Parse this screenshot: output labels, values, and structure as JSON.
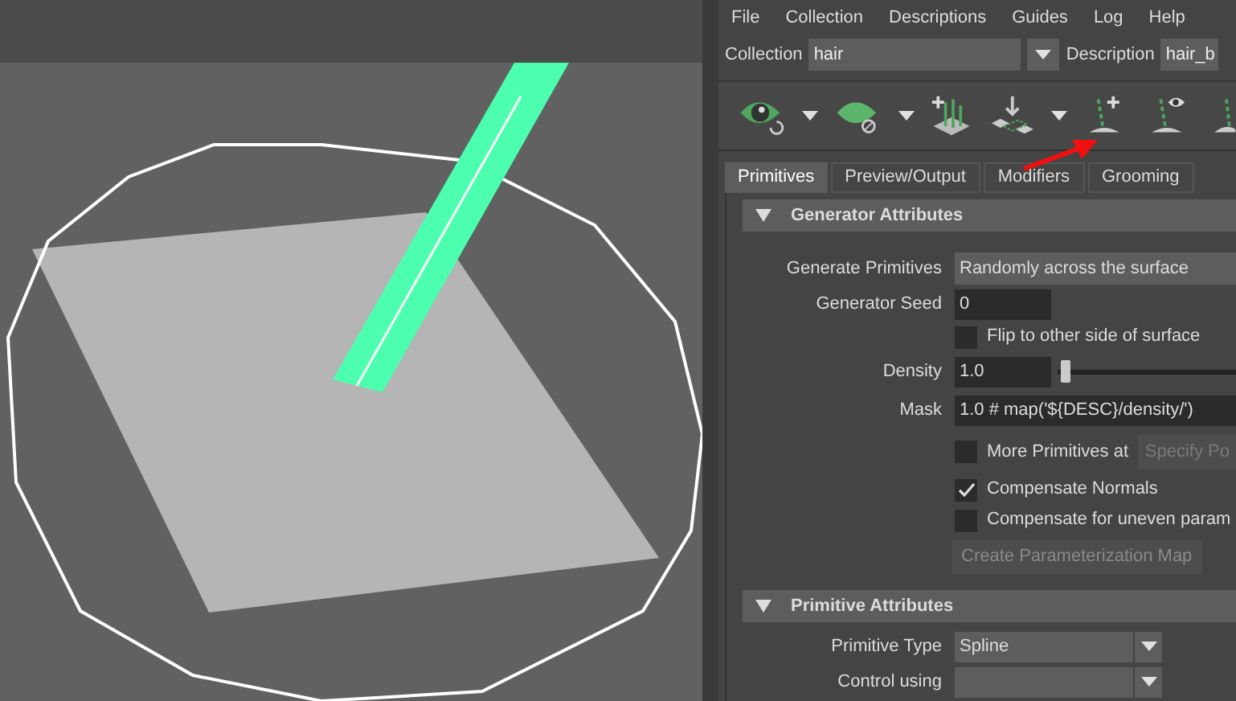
{
  "menu": [
    "File",
    "Collection",
    "Descriptions",
    "Guides",
    "Log",
    "Help"
  ],
  "selectors": [
    {
      "label": "Collection",
      "value": "hair",
      "dropdown": true
    },
    {
      "label": "Description",
      "value": "hair_b",
      "dropdown": false
    }
  ],
  "tabs": [
    {
      "label": "Primitives",
      "selected": true
    },
    {
      "label": "Preview/Output",
      "selected": false
    },
    {
      "label": "Modifiers",
      "selected": false
    },
    {
      "label": "Grooming",
      "selected": false
    }
  ],
  "sections": [
    {
      "title": "Generator Attributes",
      "expanded": true,
      "rows": [
        {
          "kind": "dropdown",
          "label": "Generate Primitives",
          "value": "Randomly across the surface"
        },
        {
          "kind": "field",
          "label": "Generator Seed",
          "value": "0"
        },
        {
          "kind": "checkbox",
          "label": "Flip to other side of surface",
          "checked": false
        },
        {
          "kind": "slider",
          "label": "Density",
          "value": "1.0",
          "level": 0.02
        },
        {
          "kind": "wide",
          "label": "Mask",
          "value": "1.0 # map('${DESC}/density/')"
        },
        {
          "kind": "checkbutton",
          "label": "More Primitives at",
          "checked": false,
          "button": "Specify Po"
        },
        {
          "kind": "checkbox",
          "label": "Compensate Normals",
          "checked": true
        },
        {
          "kind": "checkbox",
          "label": "Compensate for uneven param",
          "checked": false
        },
        {
          "kind": "button",
          "label": "Create Parameterization Map"
        }
      ]
    },
    {
      "title": "Primitive Attributes",
      "expanded": true,
      "rows": [
        {
          "kind": "select",
          "label": "Primitive Type",
          "value": "Spline"
        },
        {
          "kind": "select",
          "label": "Control using",
          "value": ""
        }
      ]
    }
  ]
}
